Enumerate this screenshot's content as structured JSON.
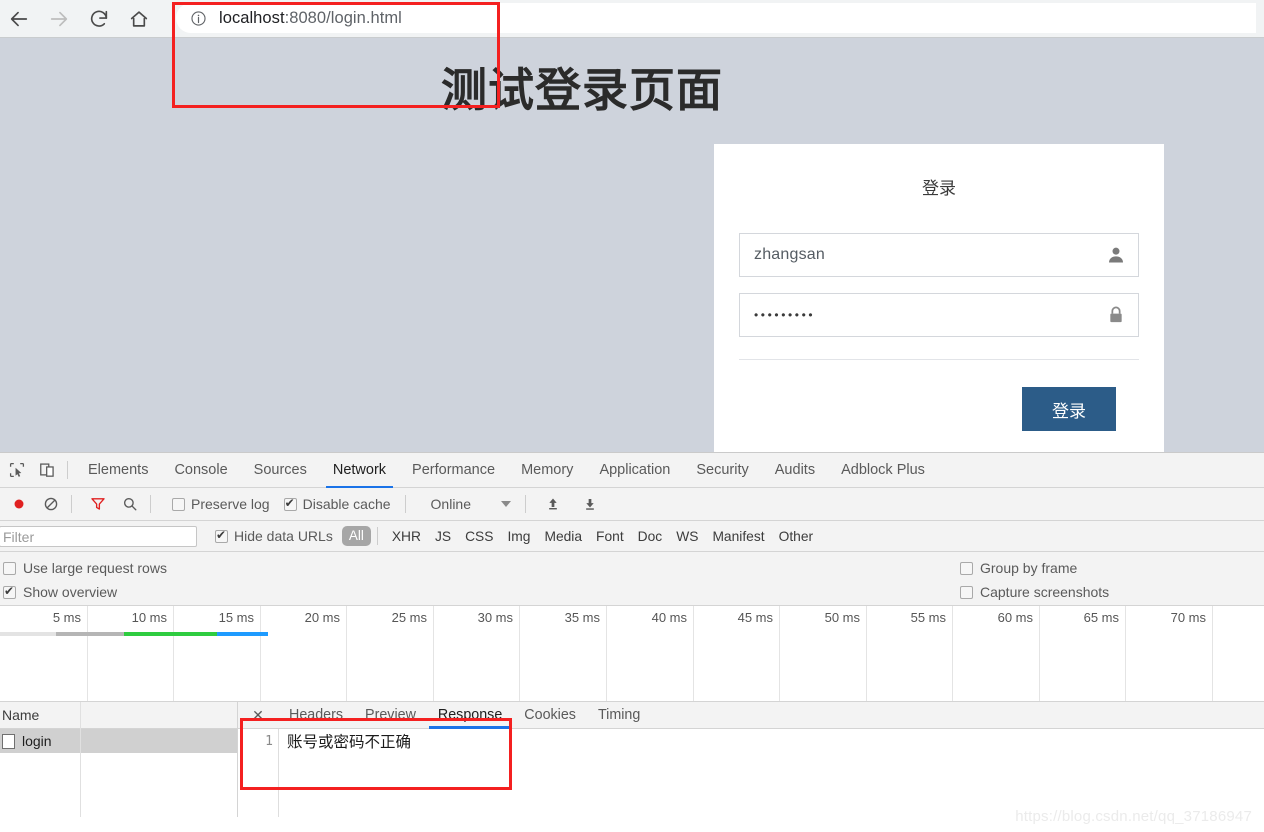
{
  "browser": {
    "nav": {
      "back_label": "Back",
      "forward_label": "Forward",
      "reload_label": "Reload",
      "home_label": "Home"
    },
    "omnibox": {
      "host": "localhost",
      "path": ":8080/login.html",
      "full_url": "localhost:8080/login.html",
      "info_icon": "info-circle-icon"
    }
  },
  "page": {
    "title": "测试登录页面",
    "background_color": "#ced3dc",
    "card": {
      "heading": "登录",
      "username": {
        "value": "zhangsan",
        "icon": "user-icon"
      },
      "password": {
        "value": "•••••••••",
        "icon": "lock-icon"
      },
      "submit_label": "登录",
      "submit_color": "#2c5c88"
    }
  },
  "devtools": {
    "panel_tabs": [
      {
        "label": "Elements",
        "active": false
      },
      {
        "label": "Console",
        "active": false
      },
      {
        "label": "Sources",
        "active": false
      },
      {
        "label": "Network",
        "active": true
      },
      {
        "label": "Performance",
        "active": false
      },
      {
        "label": "Memory",
        "active": false
      },
      {
        "label": "Application",
        "active": false
      },
      {
        "label": "Security",
        "active": false
      },
      {
        "label": "Audits",
        "active": false
      },
      {
        "label": "Adblock Plus",
        "active": false
      }
    ],
    "toolbar": {
      "record_icon": "record-circle-icon",
      "clear_icon": "clear-circle-slash-icon",
      "filter_icon": "filter-funnel-icon",
      "search_icon": "search-icon",
      "preserve_log": {
        "label": "Preserve log",
        "checked": false
      },
      "disable_cache": {
        "label": "Disable cache",
        "checked": true
      },
      "throttling": {
        "value": "Online"
      },
      "import_icon": "upload-arrow-icon",
      "export_icon": "download-arrow-icon"
    },
    "filterbar": {
      "filter_placeholder": "Filter",
      "hide_data_urls": {
        "label": "Hide data URLs",
        "checked": true
      },
      "types": [
        "All",
        "XHR",
        "JS",
        "CSS",
        "Img",
        "Media",
        "Font",
        "Doc",
        "WS",
        "Manifest",
        "Other"
      ],
      "selected_type": "All"
    },
    "options": {
      "use_large_rows": {
        "label": "Use large request rows",
        "checked": false
      },
      "show_overview": {
        "label": "Show overview",
        "checked": true
      },
      "group_by_frame": {
        "label": "Group by frame",
        "checked": false
      },
      "capture_screenshots": {
        "label": "Capture screenshots",
        "checked": false
      }
    },
    "timeline": {
      "ticks": [
        "5 ms",
        "10 ms",
        "15 ms",
        "20 ms",
        "25 ms",
        "30 ms",
        "35 ms",
        "40 ms",
        "45 ms",
        "50 ms",
        "55 ms",
        "60 ms",
        "65 ms",
        "70 ms"
      ],
      "bar_segments": [
        {
          "name": "queued",
          "color": "#e3e3e3",
          "start_pct": 0.0,
          "width_pct": 4.4
        },
        {
          "name": "stalled",
          "color": "#b5b5b5",
          "start_pct": 4.4,
          "width_pct": 5.4
        },
        {
          "name": "waiting",
          "color": "#2ecc40",
          "start_pct": 9.8,
          "width_pct": 7.4
        },
        {
          "name": "downloading",
          "color": "#1e9bff",
          "start_pct": 17.2,
          "width_pct": 4.0
        }
      ]
    },
    "requests": {
      "column_header": "Name",
      "rows": [
        {
          "name": "login",
          "icon": "document-icon",
          "selected": true
        }
      ]
    },
    "response_pane": {
      "close_icon": "close-icon",
      "tabs": [
        {
          "label": "Headers",
          "active": false
        },
        {
          "label": "Preview",
          "active": false
        },
        {
          "label": "Response",
          "active": true
        },
        {
          "label": "Cookies",
          "active": false
        },
        {
          "label": "Timing",
          "active": false
        }
      ],
      "lines": [
        {
          "number": "1",
          "text": "账号或密码不正确"
        }
      ]
    }
  },
  "annotations": {
    "url_box_color": "#f42020",
    "response_box_color": "#f42020"
  },
  "watermark": "https://blog.csdn.net/qq_37186947"
}
